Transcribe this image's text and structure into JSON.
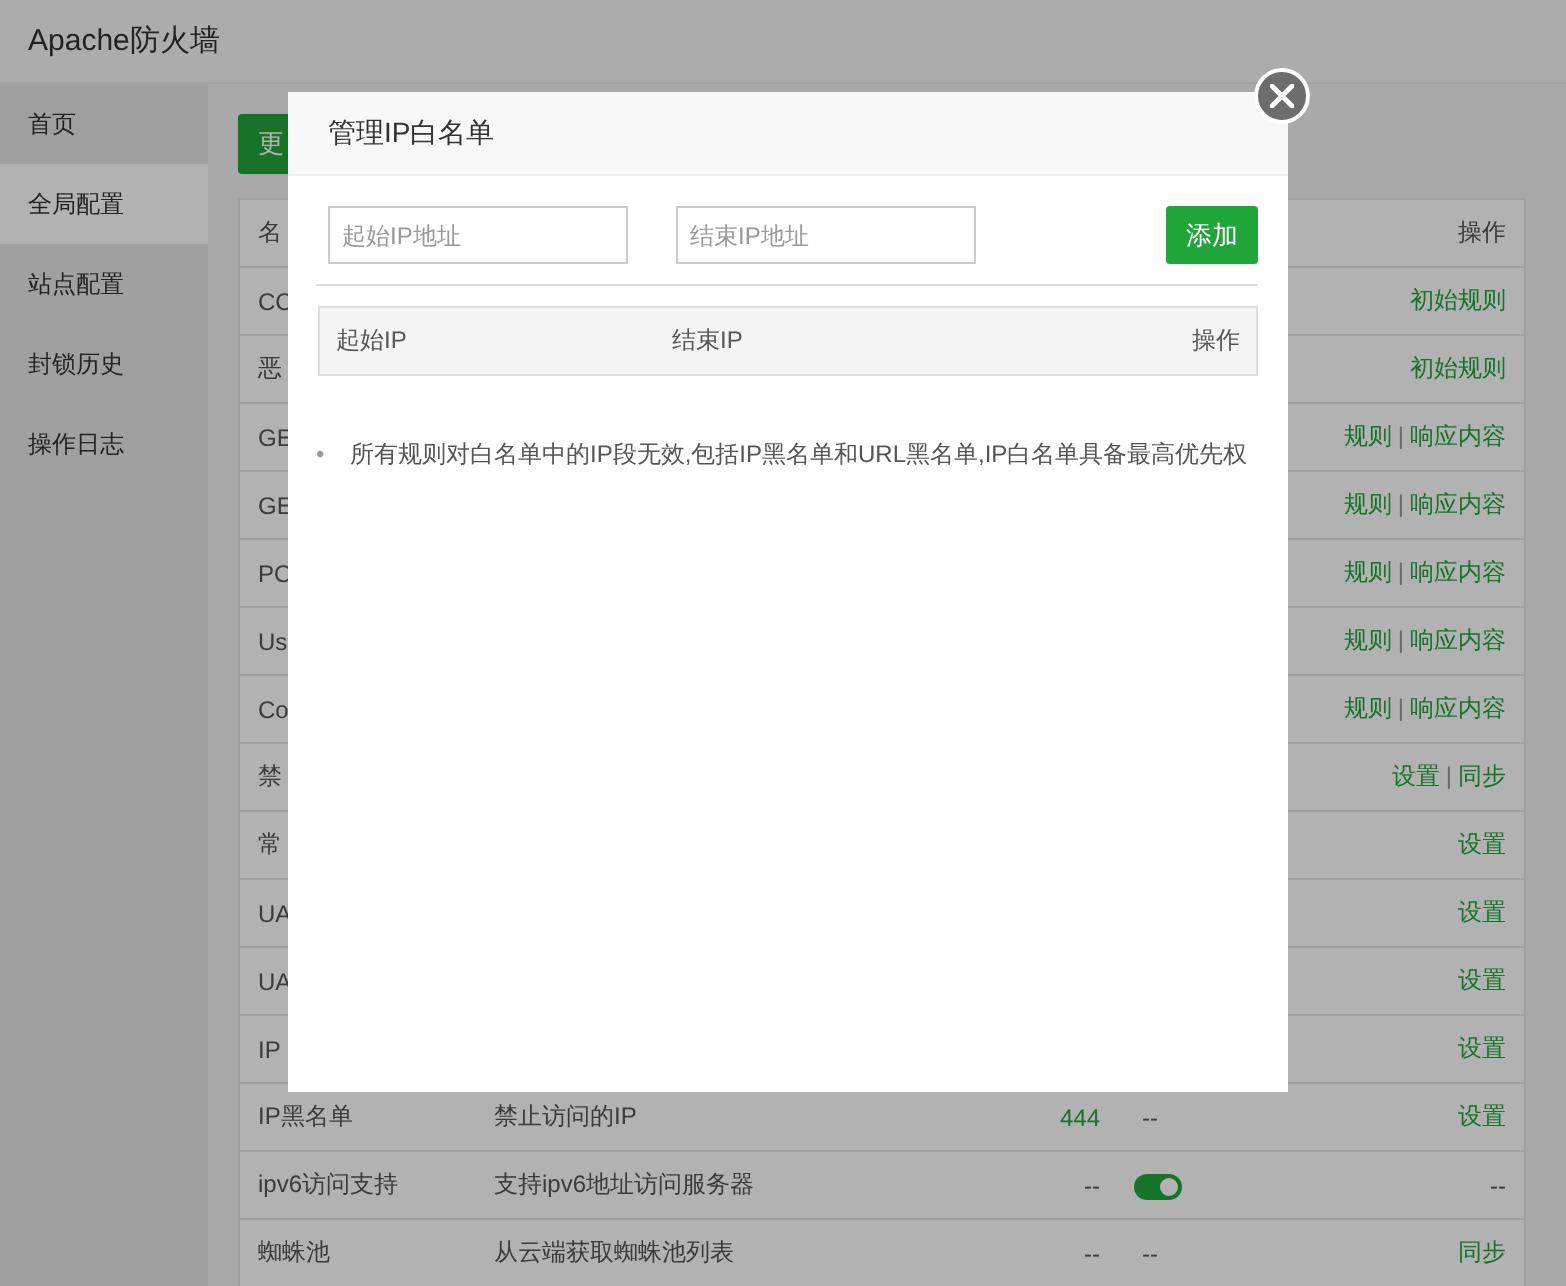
{
  "app": {
    "title": "Apache防火墙"
  },
  "sidebar": {
    "items": [
      {
        "label": "首页",
        "selected": false
      },
      {
        "label": "全局配置",
        "selected": true
      },
      {
        "label": "站点配置",
        "selected": false
      },
      {
        "label": "封锁历史",
        "selected": false
      },
      {
        "label": "操作日志",
        "selected": false
      }
    ]
  },
  "toolbar": {
    "button": "更"
  },
  "table": {
    "columns": {
      "name": "名",
      "ops": "操作"
    },
    "rows": [
      {
        "name": "CC",
        "ops": [
          "初始规则"
        ]
      },
      {
        "name": "恶",
        "ops": [
          "初始规则"
        ]
      },
      {
        "name": "GE",
        "ops": [
          "规则",
          "|",
          "响应内容"
        ]
      },
      {
        "name": "GE",
        "ops": [
          "规则",
          "|",
          "响应内容"
        ]
      },
      {
        "name": "PO",
        "ops": [
          "规则",
          "|",
          "响应内容"
        ]
      },
      {
        "name": "Us",
        "ops": [
          "规则",
          "|",
          "响应内容"
        ]
      },
      {
        "name": "Co",
        "ops": [
          "规则",
          "|",
          "响应内容"
        ]
      },
      {
        "name": "禁",
        "ops": [
          "设置",
          "|",
          "同步"
        ]
      },
      {
        "name": "常",
        "ops": [
          "设置"
        ]
      },
      {
        "name": "UA",
        "ops": [
          "设置"
        ]
      },
      {
        "name": "UA",
        "ops": [
          "设置"
        ]
      },
      {
        "name": "IP",
        "ops": [
          "设置"
        ]
      },
      {
        "name": "IP黑名单",
        "description": "禁止访问的IP",
        "count": "444",
        "status": {
          "kind": "text",
          "text": "--"
        },
        "ops": [
          "设置"
        ]
      },
      {
        "name": "ipv6访问支持",
        "description": "支持ipv6地址访问服务器",
        "count": "--",
        "status": {
          "kind": "toggle",
          "on": true
        },
        "ops": [],
        "ops_text": "--"
      },
      {
        "name": "蜘蛛池",
        "description": "从云端获取蜘蛛池列表",
        "count": "--",
        "status": {
          "kind": "text",
          "text": "--"
        },
        "ops": [
          "同步"
        ]
      }
    ]
  },
  "dialog": {
    "title": "管理IP白名单",
    "start_field": {
      "placeholder": "起始IP地址"
    },
    "end_field": {
      "placeholder": "结束IP地址"
    },
    "add_button": "添加",
    "columns": [
      "起始IP",
      "结束IP",
      "操作"
    ],
    "notes": [
      {
        "bullet": "•",
        "text": "所有规则对白名单中的IP段无效,包括IP黑名单和URL黑名单,IP白名单具备最高优先权"
      }
    ]
  }
}
